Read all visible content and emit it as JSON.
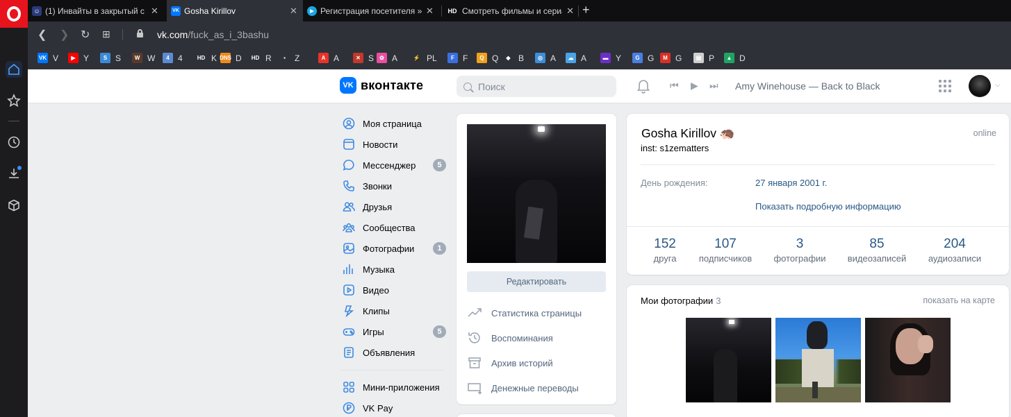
{
  "browser": {
    "tabs": [
      {
        "title": "(1) Инвайты в закрытый с",
        "fav_color": "#2b3a7a",
        "fav_text": "☺",
        "active": false
      },
      {
        "title": "Gosha Kirillov",
        "fav_color": "#0077ff",
        "fav_text": "VK",
        "active": true
      },
      {
        "title": "Регистрация посетителя »",
        "fav_color": "#1aa6e6",
        "fav_text": "▶",
        "active": false
      },
      {
        "title": "Смотреть фильмы и сериа",
        "fav_color": "#0f0f11",
        "fav_text": "HD",
        "active": false
      }
    ],
    "url_host": "vk.com",
    "url_path": "/fuck_as_i_3bashu",
    "bookmarks": [
      {
        "label": "V",
        "color": "#0077ff",
        "icon": "VK"
      },
      {
        "label": "Y",
        "color": "#ff0000",
        "icon": "▶"
      },
      {
        "label": "S",
        "color": "#3b8ad6",
        "icon": "S"
      },
      {
        "label": "W",
        "color": "#5a3a2a",
        "icon": "W"
      },
      {
        "label": "4",
        "color": "#5b8bd0",
        "icon": "4"
      },
      {
        "label": "K",
        "color": "#2f3138",
        "icon": "HD"
      },
      {
        "label": "D",
        "color": "#f08a1c",
        "icon": "DNS"
      },
      {
        "label": "R",
        "color": "#2f3138",
        "icon": "HD"
      },
      {
        "label": "Z",
        "color": "#2f3138",
        "icon": "▪"
      },
      {
        "label": "A",
        "color": "#e8332a",
        "icon": "A"
      },
      {
        "label": "S",
        "color": "#c0392b",
        "icon": "✕"
      },
      {
        "label": "A",
        "color": "#e94fa0",
        "icon": "✿"
      },
      {
        "label": "PL",
        "color": "#2f3138",
        "icon": "⚡"
      },
      {
        "label": "F",
        "color": "#3b6fe0",
        "icon": "F"
      },
      {
        "label": "Q",
        "color": "#f0a11c",
        "icon": "Q"
      },
      {
        "label": "B",
        "color": "#2f3138",
        "icon": "◆"
      },
      {
        "label": "A",
        "color": "#3d8ed6",
        "icon": "◎"
      },
      {
        "label": "A",
        "color": "#4aa3e8",
        "icon": "☁"
      },
      {
        "label": "Y",
        "color": "#6b2fc7",
        "icon": "▬"
      },
      {
        "label": "G",
        "color": "#4a7fe0",
        "icon": "G"
      },
      {
        "label": "G",
        "color": "#d93025",
        "icon": "M"
      },
      {
        "label": "P",
        "color": "#cfcfcf",
        "icon": "▤"
      },
      {
        "label": "D",
        "color": "#1fa463",
        "icon": "▲"
      }
    ]
  },
  "vk_header": {
    "logo_text": "вконтакте",
    "search_placeholder": "Поиск",
    "track": "Amy Winehouse — Back to Black"
  },
  "menu": {
    "items": [
      {
        "label": "Моя страница",
        "icon": "user-circle-icon",
        "badge": ""
      },
      {
        "label": "Новости",
        "icon": "newsfeed-icon",
        "badge": ""
      },
      {
        "label": "Мессенджер",
        "icon": "message-icon",
        "badge": "5"
      },
      {
        "label": "Звонки",
        "icon": "phone-icon",
        "badge": ""
      },
      {
        "label": "Друзья",
        "icon": "friends-icon",
        "badge": ""
      },
      {
        "label": "Сообщества",
        "icon": "communities-icon",
        "badge": ""
      },
      {
        "label": "Фотографии",
        "icon": "photo-icon",
        "badge": "1"
      },
      {
        "label": "Музыка",
        "icon": "music-icon",
        "badge": ""
      },
      {
        "label": "Видео",
        "icon": "video-icon",
        "badge": ""
      },
      {
        "label": "Клипы",
        "icon": "clips-icon",
        "badge": ""
      },
      {
        "label": "Игры",
        "icon": "games-icon",
        "badge": "5"
      },
      {
        "label": "Объявления",
        "icon": "ads-icon",
        "badge": ""
      }
    ],
    "extra_items": [
      {
        "label": "Мини-приложения",
        "icon": "mini-apps-icon"
      },
      {
        "label": "VK Pay",
        "icon": "vk-pay-icon"
      }
    ]
  },
  "profile_card": {
    "edit_label": "Редактировать",
    "links": [
      {
        "label": "Статистика страницы",
        "icon": "stats-icon"
      },
      {
        "label": "Воспоминания",
        "icon": "memories-icon"
      },
      {
        "label": "Архив историй",
        "icon": "archive-icon"
      },
      {
        "label": "Денежные переводы",
        "icon": "money-transfer-icon"
      }
    ]
  },
  "info": {
    "name": "Gosha Kirillov 🦔",
    "status": "inst: s1zematters",
    "online": "online",
    "birthday_label": "День рождения:",
    "birthday_value": "27 января 2001 г.",
    "more_info": "Показать подробную информацию",
    "counters": [
      {
        "num": "152",
        "label": "друга"
      },
      {
        "num": "107",
        "label": "подписчиков"
      },
      {
        "num": "3",
        "label": "фотографии"
      },
      {
        "num": "85",
        "label": "видеозаписей"
      },
      {
        "num": "204",
        "label": "аудиозаписи"
      }
    ]
  },
  "photos": {
    "title": "Мои фотографии",
    "count": "3",
    "map_link": "показать на карте"
  }
}
